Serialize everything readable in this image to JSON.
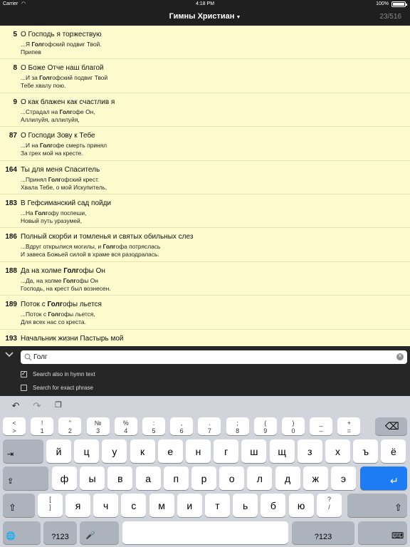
{
  "status_bar": {
    "carrier": "Carrier",
    "time": "4:18 PM",
    "battery": "100%"
  },
  "nav": {
    "title": "Гимны Христиан",
    "counter": "23/516"
  },
  "results": [
    {
      "number": "5",
      "title": "О Господь я торжествую",
      "l1": {
        "pre": "...Я ",
        "hit": "Голг",
        "post": "офский подвиг Твой."
      },
      "l2": {
        "pre": "Припев",
        "hit": "",
        "post": ""
      }
    },
    {
      "number": "8",
      "title": "О Боже Отче наш благой",
      "l1": {
        "pre": "...И за ",
        "hit": "Голг",
        "post": "офский подвиг Твой"
      },
      "l2": {
        "pre": "Тебе хвалу пою.",
        "hit": "",
        "post": ""
      }
    },
    {
      "number": "9",
      "title": "О как блажен как счастлив я",
      "l1": {
        "pre": "...Страдал на ",
        "hit": "Голг",
        "post": "офе Он,"
      },
      "l2": {
        "pre": "Аллилуйя, аллилуйя,",
        "hit": "",
        "post": ""
      }
    },
    {
      "number": "87",
      "title": "О Господи Зову к Тебе",
      "l1": {
        "pre": "...И на ",
        "hit": "Голг",
        "post": "офе смерть принял"
      },
      "l2": {
        "pre": "За грех мой на кресте.",
        "hit": "",
        "post": ""
      }
    },
    {
      "number": "164",
      "title": "Ты для меня Спаситель",
      "l1": {
        "pre": "...Принял ",
        "hit": "Голг",
        "post": "офский крест."
      },
      "l2": {
        "pre": "Хвала Тебе, о мой Искупитель,",
        "hit": "",
        "post": ""
      }
    },
    {
      "number": "183",
      "title": "В Гефсиманский сад пойди",
      "l1": {
        "pre": "...На ",
        "hit": "Голг",
        "post": "офу поспеши,"
      },
      "l2": {
        "pre": "Новый путь уразумей,",
        "hit": "",
        "post": ""
      }
    },
    {
      "number": "186",
      "title": "Полный скорби и томленья и святых обильных слез",
      "l1": {
        "pre": "...Вдруг открылися могилы, и ",
        "hit": "Голг",
        "post": "офа потряслась"
      },
      "l2": {
        "pre": "И завеса Божьей силой в храме вся разодралась.",
        "hit": "",
        "post": ""
      }
    },
    {
      "number": "188",
      "title_pre": "Да на холме ",
      "title_hit": "Голг",
      "title_post": "офы Он",
      "l1": {
        "pre": "...Да, на холме ",
        "hit": "Голг",
        "post": "офы Он"
      },
      "l2": {
        "pre": "Господь, на крест был вознесен.",
        "hit": "",
        "post": ""
      }
    },
    {
      "number": "189",
      "title_pre": "Поток с ",
      "title_hit": "Голг",
      "title_post": "офы льется",
      "l1": {
        "pre": "...Поток с ",
        "hit": "Голг",
        "post": "офы льется,"
      },
      "l2": {
        "pre": "Для всех нас со креста.",
        "hit": "",
        "post": ""
      }
    },
    {
      "number": "193",
      "title": "Начальник жизни Пастырь мой",
      "l1": {
        "pre": "",
        "hit": "",
        "post": ""
      },
      "l2": {
        "pre": "",
        "hit": "",
        "post": ""
      }
    }
  ],
  "search": {
    "value": "Голг",
    "option_text": "Search also in hymn text",
    "option_text_checked": true,
    "option_exact": "Search for exact phrase",
    "option_exact_checked": false
  },
  "keyboard": {
    "row0": [
      {
        "top": "<",
        "bot": ">"
      },
      {
        "top": "!",
        "bot": "1"
      },
      {
        "top": "\"",
        "bot": "2"
      },
      {
        "top": "№",
        "bot": "3"
      },
      {
        "top": "%",
        "bot": "4"
      },
      {
        "top": ":",
        "bot": "5"
      },
      {
        "top": ",",
        "bot": "6"
      },
      {
        "top": ".",
        "bot": "7"
      },
      {
        "top": ";",
        "bot": "8"
      },
      {
        "top": "(",
        "bot": "9"
      },
      {
        "top": ")",
        "bot": "0"
      },
      {
        "top": "_",
        "bot": "–"
      },
      {
        "top": "+",
        "bot": "="
      }
    ],
    "row1": [
      "й",
      "ц",
      "у",
      "к",
      "е",
      "н",
      "г",
      "ш",
      "щ",
      "з",
      "х",
      "ъ",
      "ё"
    ],
    "row2": [
      "ф",
      "ы",
      "в",
      "а",
      "п",
      "р",
      "о",
      "л",
      "д",
      "ж",
      "э"
    ],
    "row3_bracket": {
      "top": "[",
      "bot": "]"
    },
    "row3": [
      "я",
      "ч",
      "с",
      "м",
      "и",
      "т",
      "ь",
      "б",
      "ю"
    ],
    "row3_question": {
      "top": "?",
      "bot": "/"
    },
    "numbers_label": "?123",
    "accent_color": "#1d7cf3"
  }
}
